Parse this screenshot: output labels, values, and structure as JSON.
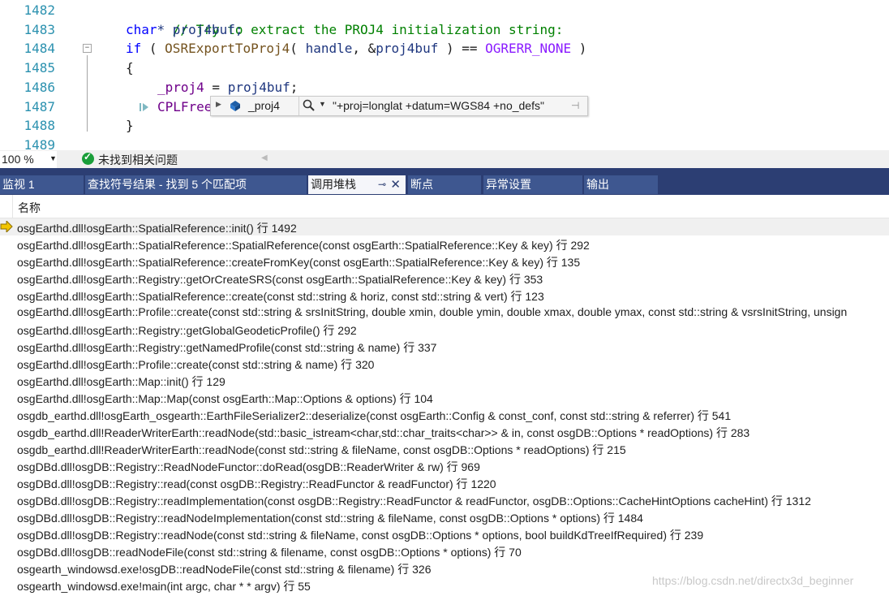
{
  "editor": {
    "line_numbers": [
      "1482",
      "1483",
      "1484",
      "1485",
      "1486",
      "1487",
      "1488",
      "1489"
    ],
    "lines": {
      "l1482_comment": "// Try to extract the PROJ4 initialization string:",
      "l1483_type": "char",
      "l1483_rest": "* proj4buf;",
      "l1484_if": "if",
      "l1484_open": " ( ",
      "l1484_fn": "OSRExportToProj4",
      "l1484_args_a": "( ",
      "l1484_handle": "handle",
      "l1484_args_b": ", &",
      "l1484_buf": "proj4buf",
      "l1484_args_c": " ) == ",
      "l1484_const": "OGRERR_NONE",
      "l1484_close": " )",
      "l1485_brace": "{",
      "l1486_lhs": "_proj4",
      "l1486_eq": " = ",
      "l1486_rhs": "proj4buf",
      "l1486_end": ";",
      "l1487_fn": "CPLFree",
      "l1488_brace": "}"
    },
    "datatip": {
      "name": "_proj4",
      "value": "\"+proj=longlat +datum=WGS84 +no_defs\""
    }
  },
  "status": {
    "zoom": "100 %",
    "issues": "未找到相关问题"
  },
  "tabs": [
    {
      "label": "监视 1",
      "active": false
    },
    {
      "label": "查找符号结果 - 找到 5 个匹配项",
      "active": false
    },
    {
      "label": "调用堆栈",
      "active": true
    },
    {
      "label": "断点",
      "active": false
    },
    {
      "label": "异常设置",
      "active": false
    },
    {
      "label": "输出",
      "active": false
    }
  ],
  "callstack": {
    "column_name": "名称",
    "frames": [
      "osgEarthd.dll!osgEarth::SpatialReference::init() 行 1492",
      "osgEarthd.dll!osgEarth::SpatialReference::SpatialReference(const osgEarth::SpatialReference::Key & key) 行 292",
      "osgEarthd.dll!osgEarth::SpatialReference::createFromKey(const osgEarth::SpatialReference::Key & key) 行 135",
      "osgEarthd.dll!osgEarth::Registry::getOrCreateSRS(const osgEarth::SpatialReference::Key & key) 行 353",
      "osgEarthd.dll!osgEarth::SpatialReference::create(const std::string & horiz, const std::string & vert) 行 123",
      "osgEarthd.dll!osgEarth::Profile::create(const std::string & srsInitString, double xmin, double ymin, double xmax, double ymax, const std::string & vsrsInitString, unsign",
      "osgEarthd.dll!osgEarth::Registry::getGlobalGeodeticProfile() 行 292",
      "osgEarthd.dll!osgEarth::Registry::getNamedProfile(const std::string & name) 行 337",
      "osgEarthd.dll!osgEarth::Profile::create(const std::string & name) 行 320",
      "osgEarthd.dll!osgEarth::Map::init() 行 129",
      "osgEarthd.dll!osgEarth::Map::Map(const osgEarth::Map::Options & options) 行 104",
      "osgdb_earthd.dll!osgEarth_osgearth::EarthFileSerializer2::deserialize(const osgEarth::Config & const_conf, const std::string & referrer) 行 541",
      "osgdb_earthd.dll!ReaderWriterEarth::readNode(std::basic_istream<char,std::char_traits<char>> & in, const osgDB::Options * readOptions) 行 283",
      "osgdb_earthd.dll!ReaderWriterEarth::readNode(const std::string & fileName, const osgDB::Options * readOptions) 行 215",
      "osgDBd.dll!osgDB::Registry::ReadNodeFunctor::doRead(osgDB::ReaderWriter & rw) 行 969",
      "osgDBd.dll!osgDB::Registry::read(const osgDB::Registry::ReadFunctor & readFunctor) 行 1220",
      "osgDBd.dll!osgDB::Registry::readImplementation(const osgDB::Registry::ReadFunctor & readFunctor, osgDB::Options::CacheHintOptions cacheHint) 行 1312",
      "osgDBd.dll!osgDB::Registry::readNodeImplementation(const std::string & fileName, const osgDB::Options * options) 行 1484",
      "osgDBd.dll!osgDB::Registry::readNode(const std::string & fileName, const osgDB::Options * options, bool buildKdTreeIfRequired) 行 239",
      "osgDBd.dll!osgDB::readNodeFile(const std::string & filename, const osgDB::Options * options) 行 70",
      "osgearth_windowsd.exe!osgDB::readNodeFile(const std::string & filename) 行 326",
      "osgearth_windowsd.exe!main(int argc, char * * argv) 行 55"
    ]
  },
  "watermark": "https://blog.csdn.net/directx3d_beginner",
  "colors": {
    "tab_bar": "#2c3e73",
    "tab_inactive": "#3e5790",
    "current_frame_arrow": "#f2c500"
  }
}
